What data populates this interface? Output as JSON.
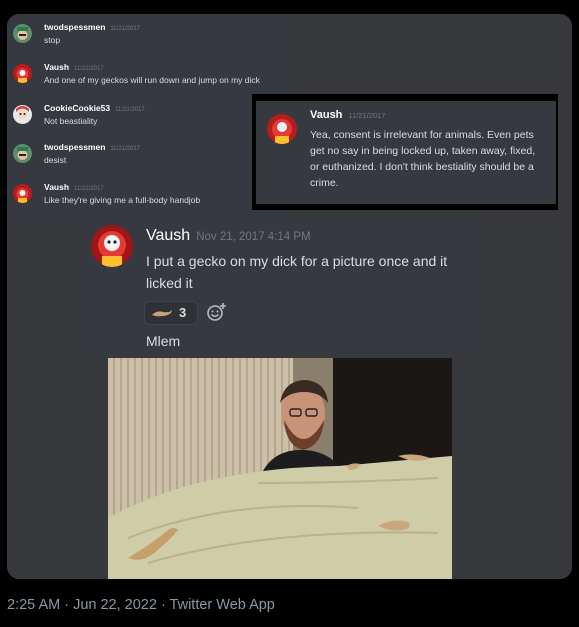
{
  "log": {
    "messages": [
      {
        "author": "twodspessmen",
        "timestamp": "11/21/2017",
        "text": "stop",
        "avatar": "green-cap-avatar"
      },
      {
        "author": "Vaush",
        "timestamp": "11/21/2017",
        "text": "And one of my geckos will run down and jump on my dick",
        "avatar": "red-avatar"
      },
      {
        "author": "CookieCookie53",
        "timestamp": "11/21/2017",
        "text": "Not beastiality",
        "avatar": "anime-avatar"
      },
      {
        "author": "twodspessmen",
        "timestamp": "11/21/2017",
        "text": "desist",
        "avatar": "green-cap-avatar"
      },
      {
        "author": "Vaush",
        "timestamp": "11/21/2017",
        "text": "Like they're giving me a full-body handjob",
        "avatar": "red-avatar"
      }
    ]
  },
  "quote": {
    "author": "Vaush",
    "timestamp": "11/21/2017",
    "text": "Yea, consent is irrelevant for animals. Even pets get no say in being locked up, taken away, fixed, or euthanized. I don't think bestiality should be a crime."
  },
  "main_message": {
    "author": "Vaush",
    "timestamp": "Nov 21, 2017 4:14 PM",
    "text": "I put a gecko on my dick for a picture once and it licked it",
    "reaction_emoji": "gecko-emoji",
    "reaction_count": "3",
    "add_reaction_icon": "add-reaction-icon",
    "reply": "Mlem"
  },
  "photo": {
    "description_icon": "photo"
  },
  "tweet_footer": "2:25 AM · Jun 22, 2022 · Twitter Web App",
  "colors": {
    "discord_bg": "#36393f",
    "name": "#ffffff",
    "text": "#dcddde",
    "timestamp": "#72767d",
    "footer": "#8b98a5"
  }
}
